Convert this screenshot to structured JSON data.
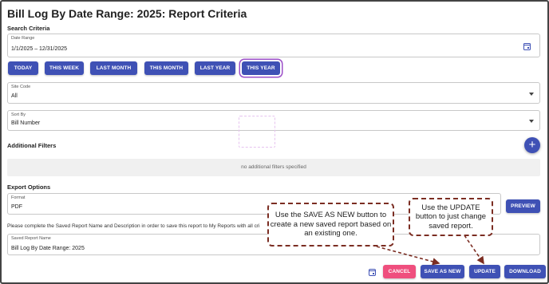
{
  "page": {
    "title": "Bill Log By Date Range: 2025: Report Criteria"
  },
  "search": {
    "section_label": "Search Criteria",
    "date_range": {
      "label": "Date Range",
      "value": "1/1/2025 – 12/31/2025"
    },
    "quick_ranges": [
      {
        "label": "TODAY"
      },
      {
        "label": "THIS WEEK"
      },
      {
        "label": "LAST MONTH"
      },
      {
        "label": "THIS MONTH"
      },
      {
        "label": "LAST YEAR"
      },
      {
        "label": "THIS YEAR",
        "selected": true
      }
    ],
    "site_code": {
      "label": "Site Code",
      "value": "All"
    },
    "sort_by": {
      "label": "Sort By",
      "value": "Bill Number"
    }
  },
  "filters": {
    "section_label": "Additional Filters",
    "empty_text": "no additional filters specified",
    "add_icon": "plus-icon"
  },
  "export": {
    "section_label": "Export Options",
    "format": {
      "label": "Format",
      "value": "PDF"
    },
    "preview_label": "PREVIEW"
  },
  "notice": "Please complete the Saved Report Name and Description in order to save this report to My Reports with all cri",
  "saved_report": {
    "label": "Saved Report Name",
    "value": "Bill Log By Date Range: 2025"
  },
  "actions": {
    "cancel_label": "CANCEL",
    "save_as_new_label": "SAVE AS NEW",
    "update_label": "UPDATE",
    "download_label": "DOWNLOAD",
    "schedule_icon": "calendar-clock-icon"
  },
  "callouts": {
    "save_as_new": "Use the SAVE AS NEW button to create a new saved report based on an existing one.",
    "update": "Use the UPDATE button to just change saved report."
  },
  "colors": {
    "primary": "#3f51b5",
    "cancel": "#ef4f7e",
    "callout_border": "#7b2d22",
    "selected_outline": "#9c4fc8"
  }
}
